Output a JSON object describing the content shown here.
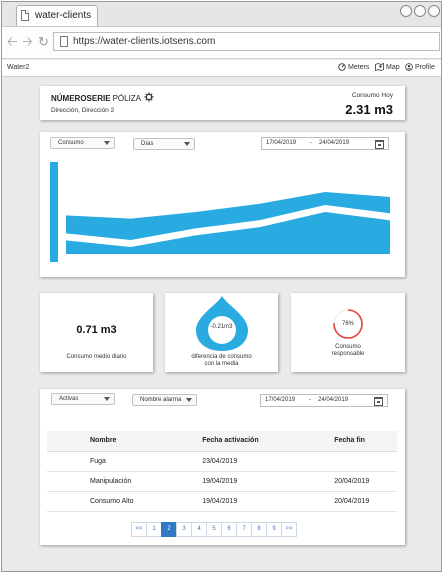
{
  "browser": {
    "tab_title": "water-clients",
    "url": "https://water-clients.iotsens.com"
  },
  "app": {
    "brand": "Water2",
    "nav": [
      {
        "label": "Meters",
        "icon": "gauge-icon"
      },
      {
        "label": "Map",
        "icon": "map-icon"
      },
      {
        "label": "Profile",
        "icon": "user-icon"
      }
    ]
  },
  "header": {
    "serie": "NÚMEROSERIE",
    "poliza": "PÓLIZA",
    "direccion": "Dirección, Dirección 2",
    "consumo_label": "Consumo Hoy",
    "consumo_value": "2.31 m3"
  },
  "chart_controls": {
    "metric": "Consumo",
    "period": "Días",
    "date_from": "17/04/2019",
    "date_sep": "-",
    "date_to": "24/04/2019"
  },
  "chart_data": {
    "type": "area",
    "color": "#29abe2",
    "series": [
      {
        "values": [
          6.0,
          0.0
        ]
      },
      {
        "values": [
          2.8,
          2.6,
          3.0,
          3.5,
          4.2,
          3.9
        ]
      },
      {
        "values": [
          1.3,
          0.9,
          1.6,
          2.1,
          3.0,
          2.5
        ]
      }
    ],
    "grid": false
  },
  "kpis": {
    "medio_value": "0.71 m3",
    "medio_label": "Consumo medio diario",
    "diff_value": "-0.21m3",
    "diff_label_1": "diferencia de consumo",
    "diff_label_2": "con la media",
    "resp_value": "76%",
    "resp_fraction": 0.76,
    "resp_label_1": "Consumo",
    "resp_label_2": "responsable"
  },
  "alarms": {
    "filter_status": "Activas",
    "filter_name": "Nombre alarma",
    "date_from": "17/04/2019",
    "date_sep": "-",
    "date_to": "24/04/2019",
    "columns": [
      "Nombre",
      "Fecha activación",
      "Fecha fin"
    ],
    "rows": [
      [
        "Fuga",
        "23/04/2019",
        ""
      ],
      [
        "Manipulación",
        "19/04/2019",
        "20/04/2019"
      ],
      [
        "Consumo Alto",
        "19/04/2019",
        "20/04/2019"
      ]
    ]
  },
  "pagination": {
    "pages": [
      "<<",
      "1",
      "2",
      "3",
      "4",
      "5",
      "6",
      "7",
      "8",
      "9",
      ">>"
    ],
    "active": "2"
  },
  "colors": {
    "accent": "#29abe2",
    "ring": "#e8413c",
    "page_active": "#2f79c6"
  }
}
